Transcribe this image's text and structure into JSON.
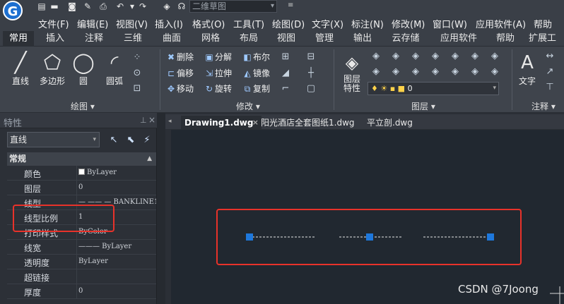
{
  "quick_access": {
    "logo": "G",
    "icons": [
      "new-file-icon",
      "open-folder-icon",
      "save-icon",
      "save-as-icon",
      "print-icon",
      "undo-icon",
      "redo-icon",
      "layers-icon",
      "headset-icon"
    ],
    "workspace_value": "二维草图"
  },
  "menu": {
    "items": [
      "文件(F)",
      "编辑(E)",
      "视图(V)",
      "插入(I)",
      "格式(O)",
      "工具(T)",
      "绘图(D)",
      "文字(X)",
      "标注(N)",
      "修改(M)",
      "窗口(W)",
      "应用软件(A)",
      "帮助"
    ]
  },
  "ribbon_tabs": {
    "items": [
      "常用",
      "插入",
      "注释",
      "三维",
      "曲面",
      "网格",
      "布局",
      "视图",
      "管理",
      "输出",
      "云存储",
      "应用软件",
      "帮助",
      "扩展工"
    ],
    "active_index": 0
  },
  "ribbon": {
    "draw": {
      "title": "绘图",
      "tools": [
        "直线",
        "多边形",
        "圆",
        "圆弧"
      ]
    },
    "modify": {
      "title": "修改",
      "tools": [
        "删除",
        "分解",
        "布尔",
        "偏移",
        "拉伸",
        "镜像",
        "移动",
        "旋转",
        "复制"
      ]
    },
    "layers": {
      "title": "图层",
      "big_tool": "图层特性",
      "combo_value": "0"
    },
    "annotation": {
      "title": "注释",
      "big_tool": "文字"
    }
  },
  "properties": {
    "title": "特性",
    "object_type": "直线",
    "section": "常规",
    "rows": [
      {
        "label": "颜色",
        "value": "ByLayer",
        "swatch": true
      },
      {
        "label": "图层",
        "value": "0"
      },
      {
        "label": "线型",
        "value": "— —— — BANKLINE1"
      },
      {
        "label": "线型比例",
        "value": "1"
      },
      {
        "label": "打印样式",
        "value": "ByColor"
      },
      {
        "label": "线宽",
        "value": "——— ByLayer"
      },
      {
        "label": "透明度",
        "value": "ByLayer"
      },
      {
        "label": "超链接",
        "value": ""
      },
      {
        "label": "厚度",
        "value": "0"
      }
    ]
  },
  "documents": {
    "tabs": [
      "Drawing1.dwg",
      "阳光酒店全套图纸1.dwg",
      "平立剖.dwg"
    ],
    "active_index": 0
  },
  "watermark": "CSDN @7Joong",
  "colors": {
    "grip_blue": "#1e78dc",
    "highlight_red": "#e8322a",
    "canvas_bg": "#212830"
  }
}
